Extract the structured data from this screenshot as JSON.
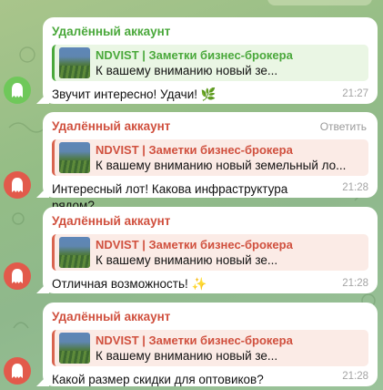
{
  "colors": {
    "green_accent": "#4aa83b",
    "red_accent": "#d0503e",
    "bubble": "#ffffff",
    "time_text": "#a4a4a4"
  },
  "messages": [
    {
      "sender": "Удалённый аккаунт",
      "avatar_icon": "ghost-icon",
      "quote_title": "NDVIST | Заметки бизнес-брокера",
      "quote_text": "К вашему вниманию новый зе...",
      "text": "Звучит интересно! Удачи! 🌿",
      "time": "21:27"
    },
    {
      "sender": "Удалённый аккаунт",
      "reply_label": "Ответить",
      "avatar_icon": "ghost-icon",
      "quote_title": "NDVIST | Заметки бизнес-брокера",
      "quote_text": "К вашему вниманию новый земельный ло...",
      "text": "Интересный лот! Какова инфраструктура рядом?",
      "time": "21:28"
    },
    {
      "sender": "Удалённый аккаунт",
      "avatar_icon": "ghost-icon",
      "quote_title": "NDVIST | Заметки бизнес-брокера",
      "quote_text": "К вашему вниманию новый зе...",
      "text": "Отличная возможность! ✨",
      "time": "21:28"
    },
    {
      "sender": "Удалённый аккаунт",
      "avatar_icon": "ghost-icon",
      "quote_title": "NDVIST | Заметки бизнес-брокера",
      "quote_text": "К вашему вниманию новый зе...",
      "text": "Какой размер скидки для оптовиков?",
      "time": "21:28"
    }
  ]
}
